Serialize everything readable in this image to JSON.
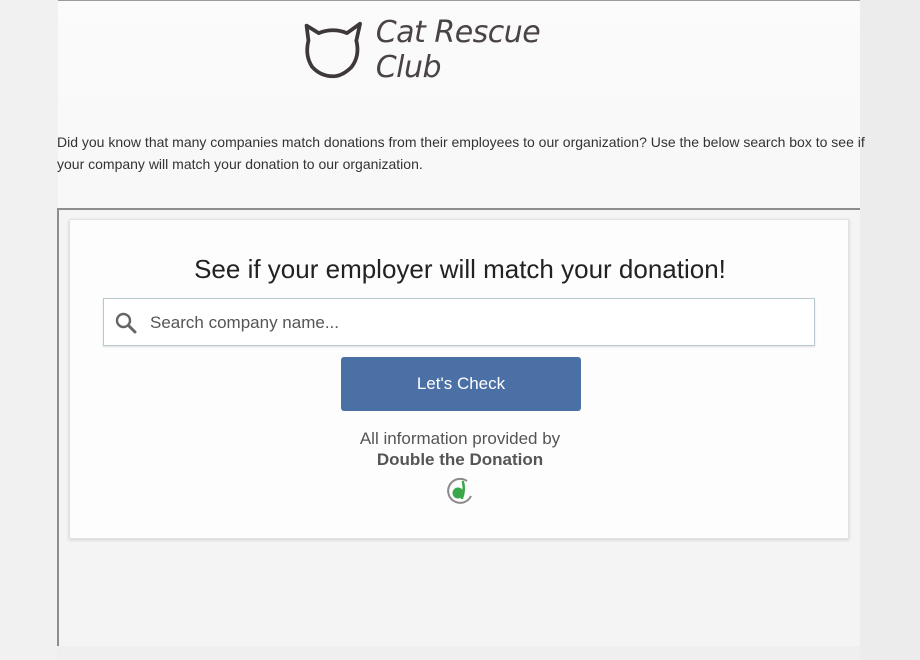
{
  "header": {
    "brand_name": "Cat Rescue Club",
    "logo_icon": "cat-head-outline-icon"
  },
  "intro": {
    "text": "Did you know that many companies match donations from their employees to our organization? Use the below search box to see if your company will match your donation to our organization."
  },
  "widget": {
    "title": "See if your employer will match your donation!",
    "search": {
      "placeholder": "Search company name...",
      "value": "",
      "icon": "search-icon"
    },
    "check_button_label": "Let's Check",
    "provided_by": "All information provided by",
    "provider_name": "Double the Donation",
    "provider_logo_icon": "double-the-donation-logo-icon"
  },
  "colors": {
    "button": "#4b70a6",
    "logo_text": "#4a4343",
    "provider_logo_green": "#3aa84a"
  }
}
